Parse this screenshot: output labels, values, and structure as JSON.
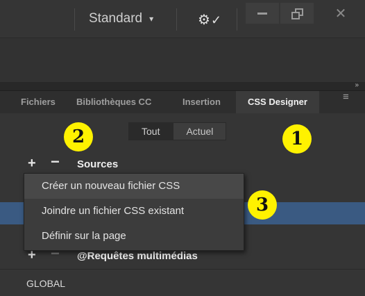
{
  "titlebar": {
    "workspace_label": "Standard",
    "workspace_chevron": "▾",
    "sync_icon": "gear-check-icon",
    "window_buttons": [
      "minimize",
      "restore",
      "close"
    ],
    "close_glyph": "✕"
  },
  "panel": {
    "collapse_glyph": "»",
    "tabs": [
      "Fichiers",
      "Bibliothèques CC",
      "Insertion",
      "CSS Designer"
    ],
    "active_tab": "CSS Designer",
    "menu_glyph": "≡"
  },
  "toggle": {
    "all": "Tout",
    "current": "Actuel",
    "selected": "Tout"
  },
  "sources": {
    "plus": "+",
    "minus": "−",
    "label": "Sources"
  },
  "context_menu": {
    "items": [
      "Créer un nouveau fichier CSS",
      "Joindre un fichier CSS existant",
      "Définir sur la page"
    ],
    "highlighted_index": 0
  },
  "media_queries": {
    "plus": "+",
    "minus": "−",
    "label": "@Requêtes multimédias"
  },
  "global_label": "GLOBAL",
  "annotations": [
    "1",
    "2",
    "3"
  ],
  "colors": {
    "selection_blue": "#3a5a82",
    "badge_yellow": "#fff200",
    "panel_bg": "#353535"
  }
}
